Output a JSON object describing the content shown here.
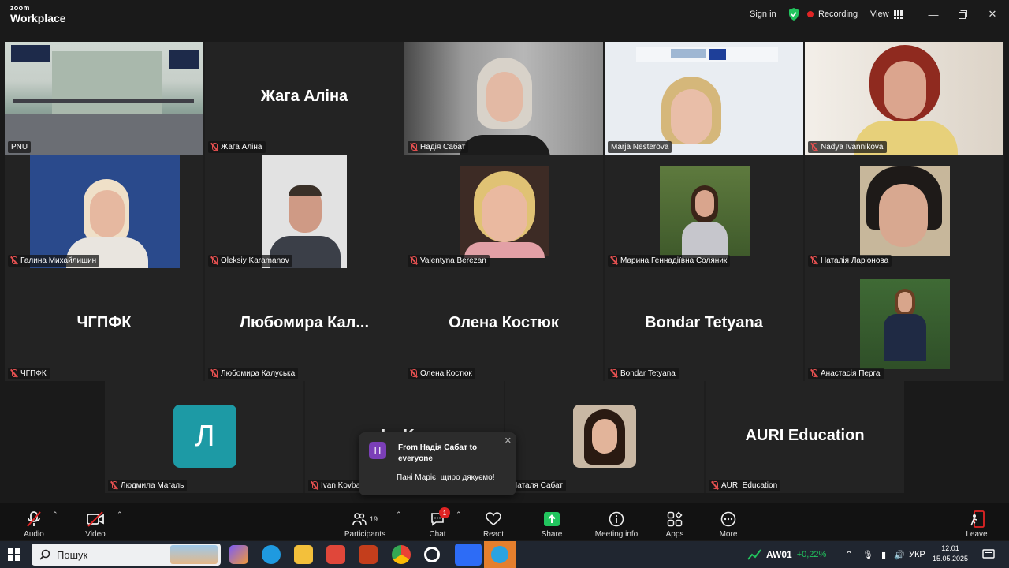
{
  "titlebar": {
    "brand_small": "zoom",
    "brand_large": "Workplace",
    "sign_in": "Sign in",
    "recording": "Recording",
    "view": "View"
  },
  "grid": {
    "row1": [
      {
        "name": "PNU",
        "muted": false,
        "big_name": ""
      },
      {
        "name": "Жага Аліна",
        "muted": true,
        "big_name": "Жага Аліна"
      },
      {
        "name": "Надія Сабат",
        "muted": true,
        "big_name": ""
      },
      {
        "name": "Marja Nesterova",
        "muted": false,
        "big_name": ""
      },
      {
        "name": "Nadya Ivannikova",
        "muted": true,
        "big_name": ""
      }
    ],
    "row2": [
      {
        "name": "Галина Михайлишин",
        "muted": true
      },
      {
        "name": "Oleksiy Karamanov",
        "muted": true
      },
      {
        "name": "Valentyna Berezan",
        "muted": true
      },
      {
        "name": "Марина Геннадіївна Соляник",
        "muted": true
      },
      {
        "name": "Наталія Ларіонова",
        "muted": true
      }
    ],
    "row3": [
      {
        "name": "ЧГПФК",
        "muted": true,
        "big_name": "ЧГПФК"
      },
      {
        "name": "Любомира Калуська",
        "muted": true,
        "big_name": "Любомира  Кал..."
      },
      {
        "name": "Олена Костюк",
        "muted": true,
        "big_name": "Олена Костюк"
      },
      {
        "name": "Bondar Tetyana",
        "muted": true,
        "big_name": "Bondar Tetyana"
      },
      {
        "name": "Анастасія Перга",
        "muted": true,
        "big_name": ""
      }
    ],
    "row4": [
      {
        "name": "Людмила Магаль",
        "muted": true,
        "avatar_letter": "Л"
      },
      {
        "name": "Ivan Kovba",
        "muted": true,
        "big_name": "I... K..."
      },
      {
        "name": "Наталя Сабат",
        "muted": false
      },
      {
        "name": "AURI Education",
        "muted": true,
        "big_name": "AURI Education"
      }
    ]
  },
  "chat_popup": {
    "avatar_letter": "H",
    "from": "From Надія Сабат to everyone",
    "message": "Пані Маріє, щиро дякуємо!"
  },
  "toolbar": {
    "audio": "Audio",
    "video": "Video",
    "participants": "Participants",
    "participants_count": "19",
    "chat": "Chat",
    "chat_badge": "1",
    "react": "React",
    "share": "Share",
    "meeting_info": "Meeting info",
    "apps": "Apps",
    "more": "More",
    "leave": "Leave"
  },
  "taskbar": {
    "search_placeholder": "Пошук",
    "stock_ticker": "AW01",
    "stock_change": "+0,22%",
    "language": "УКР",
    "time": "12:01",
    "date": "15.05.2025"
  },
  "colors": {
    "active_speaker": "#34c759",
    "recording_dot": "#e02424",
    "share_green": "#22c55e",
    "leave_red": "#e02424"
  }
}
